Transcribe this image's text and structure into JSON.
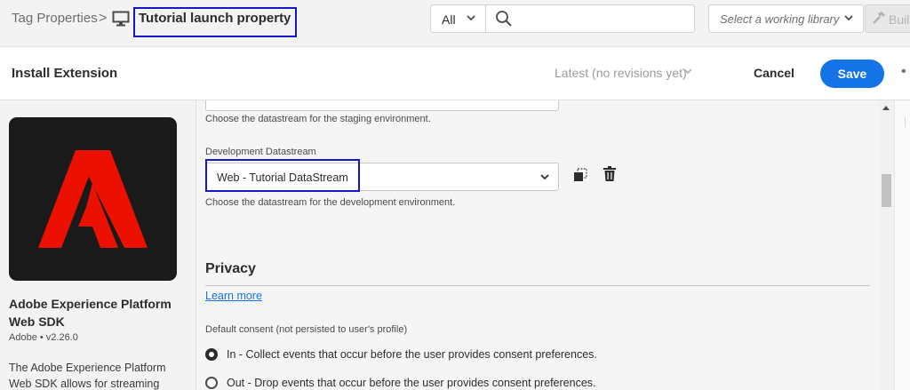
{
  "breadcrumb": {
    "root": "Tag Properties",
    "separator": ">",
    "property": "Tutorial launch property"
  },
  "search": {
    "scope": "All",
    "placeholder": ""
  },
  "library": {
    "placeholder": "Select a working library"
  },
  "build": {
    "label": "Buil"
  },
  "header": {
    "title": "Install Extension",
    "revision": "Latest (no revisions yet)",
    "cancel": "Cancel",
    "save": "Save",
    "more": "•"
  },
  "extension": {
    "name": "Adobe Experience Platform Web SDK",
    "version": "Adobe • v2.26.0",
    "description": "The Adobe Experience Platform Web SDK allows for streaming"
  },
  "form": {
    "staging_help": "Choose the datastream for the staging environment.",
    "development_label": "Development Datastream",
    "development_value": "Web - Tutorial DataStream",
    "development_help": "Choose the datastream for the development environment.",
    "privacy_heading": "Privacy",
    "learn_more": "Learn more",
    "consent_label": "Default consent (not persisted to user's profile)",
    "consent_options": [
      {
        "label": "In - Collect events that occur before the user provides consent preferences.",
        "selected": true
      },
      {
        "label": "Out - Drop events that occur before the user provides consent preferences.",
        "selected": false
      }
    ]
  },
  "icons": {
    "breadcrumb": "monitor-icon",
    "search": "search-icon",
    "build": "hammer-icon",
    "copy": "copy-icon",
    "delete": "trash-icon",
    "logo": "adobe-logo"
  },
  "colors": {
    "accent": "#1473e6",
    "highlight": "#1416c9",
    "logo_red": "#eb1000",
    "logo_bg": "#1a1a1a"
  }
}
